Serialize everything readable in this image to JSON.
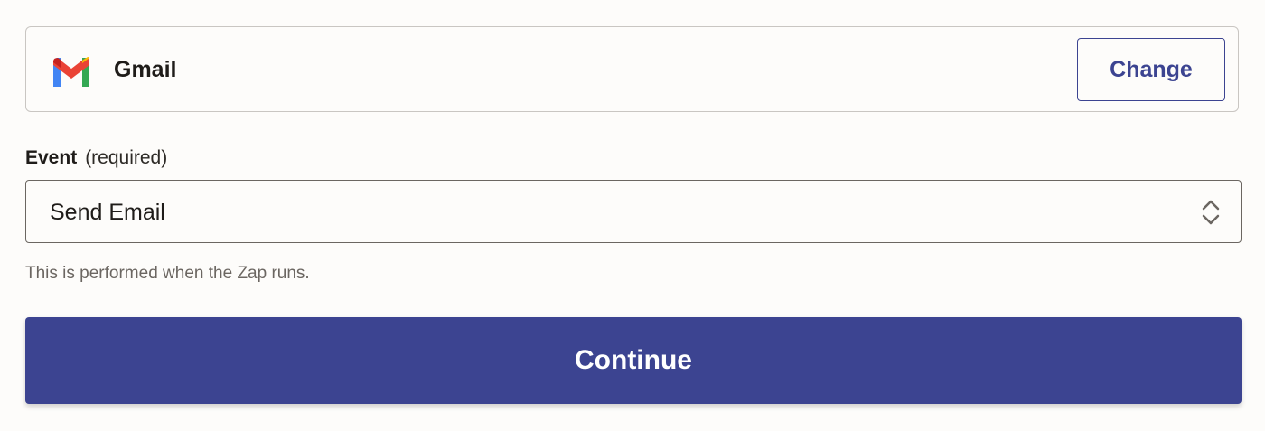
{
  "app": {
    "name": "Gmail",
    "logo_icon": "gmail-logo-icon",
    "change_label": "Change"
  },
  "event": {
    "label": "Event",
    "required_text": "(required)",
    "selected_value": "Send Email",
    "chevron_icon": "chevron-up-down-icon",
    "help_text": "This is performed when the Zap runs."
  },
  "actions": {
    "continue_label": "Continue"
  },
  "colors": {
    "accent": "#3c4491",
    "background": "#fdfcfa",
    "border": "#c9c6c2",
    "text": "#1f1c19",
    "muted_text": "#6b6661"
  }
}
